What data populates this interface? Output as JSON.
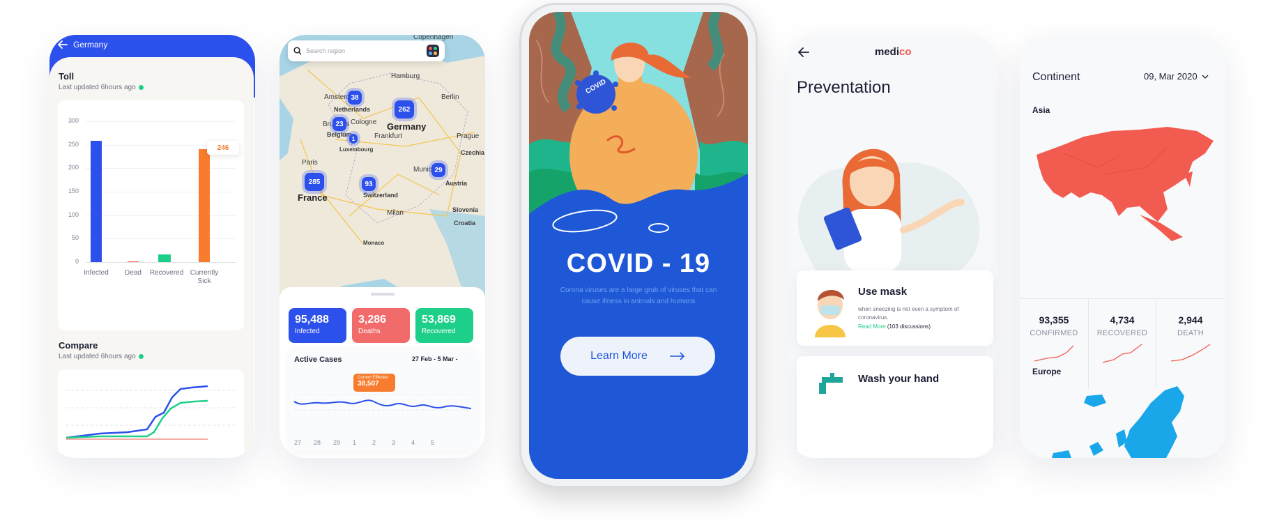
{
  "screen1": {
    "back_label": "Germany",
    "toll_title": "Toll",
    "toll_updated": "Last updated 6hours ago",
    "y_ticks": [
      "300",
      "250",
      "200",
      "150",
      "100",
      "50",
      "0"
    ],
    "bars": [
      {
        "label": "Infected",
        "value": 258,
        "color": "#2c50ec"
      },
      {
        "label": "Dead",
        "value": 1,
        "color": "#f25b4f"
      },
      {
        "label": "Recovered",
        "value": 16,
        "color": "#1ecf8a"
      },
      {
        "label": "Currently Sick",
        "value": 241,
        "color": "#f87c2d"
      }
    ],
    "bar_callout": "246",
    "compare_title": "Compare",
    "compare_updated": "Last updated 6hours ago"
  },
  "screen2": {
    "search_placeholder": "Search region",
    "clusters": [
      "38",
      "262",
      "23",
      "1",
      "29",
      "285",
      "93"
    ],
    "cities": [
      "Copenhagen",
      "Hamburg",
      "Amsterdam",
      "Netherlands",
      "Berlin",
      "Germany",
      "Cologne",
      "Prague",
      "Brussels",
      "Belgium",
      "Frankfurt",
      "Luxembourg",
      "Czechia",
      "Paris",
      "Munich",
      "Austria",
      "France",
      "Switzerland",
      "Slovenia",
      "Milan",
      "Croatia",
      "Monaco"
    ],
    "stats": [
      {
        "value": "95,488",
        "label": "Infected",
        "color": "#2c50ec"
      },
      {
        "value": "3,286",
        "label": "Deaths",
        "color": "#f26b6b"
      },
      {
        "value": "53,869",
        "label": "Recovered",
        "color": "#1ecf8a"
      }
    ],
    "active_title": "Active Cases",
    "date_range": "27 Feb - 5 Mar -",
    "tooltip_label": "Current Effected",
    "tooltip_value": "38,507",
    "x_ticks": [
      "27",
      "28",
      "29",
      "1",
      "2",
      "3",
      "4",
      "5"
    ]
  },
  "phone": {
    "badge": "COVID",
    "title": "COVID - 19",
    "description": "Corona viruses are a large grub of viruses that can cause illness in animals and humans",
    "cta": "Learn More"
  },
  "screen4": {
    "brand_a": "medi",
    "brand_b": "co",
    "title": "Preventation",
    "tips": [
      {
        "title": "Use mask",
        "body": "when sneezing is not even a symptom of coronavirus.",
        "link": "Read More",
        "meta": "(103 discussions)"
      },
      {
        "title": "Wash your hand"
      }
    ]
  },
  "screen5": {
    "title": "Continent",
    "date": "09, Mar 2020",
    "regions": [
      "Asia",
      "Europe"
    ],
    "kpis": [
      {
        "value": "93,355",
        "label": "CONFIRMED"
      },
      {
        "value": "4,734",
        "label": "RECOVERED"
      },
      {
        "value": "2,944",
        "label": "DEATH"
      }
    ],
    "colors": {
      "asia": "#f25b4f",
      "europe": "#1aa7ea"
    }
  }
}
